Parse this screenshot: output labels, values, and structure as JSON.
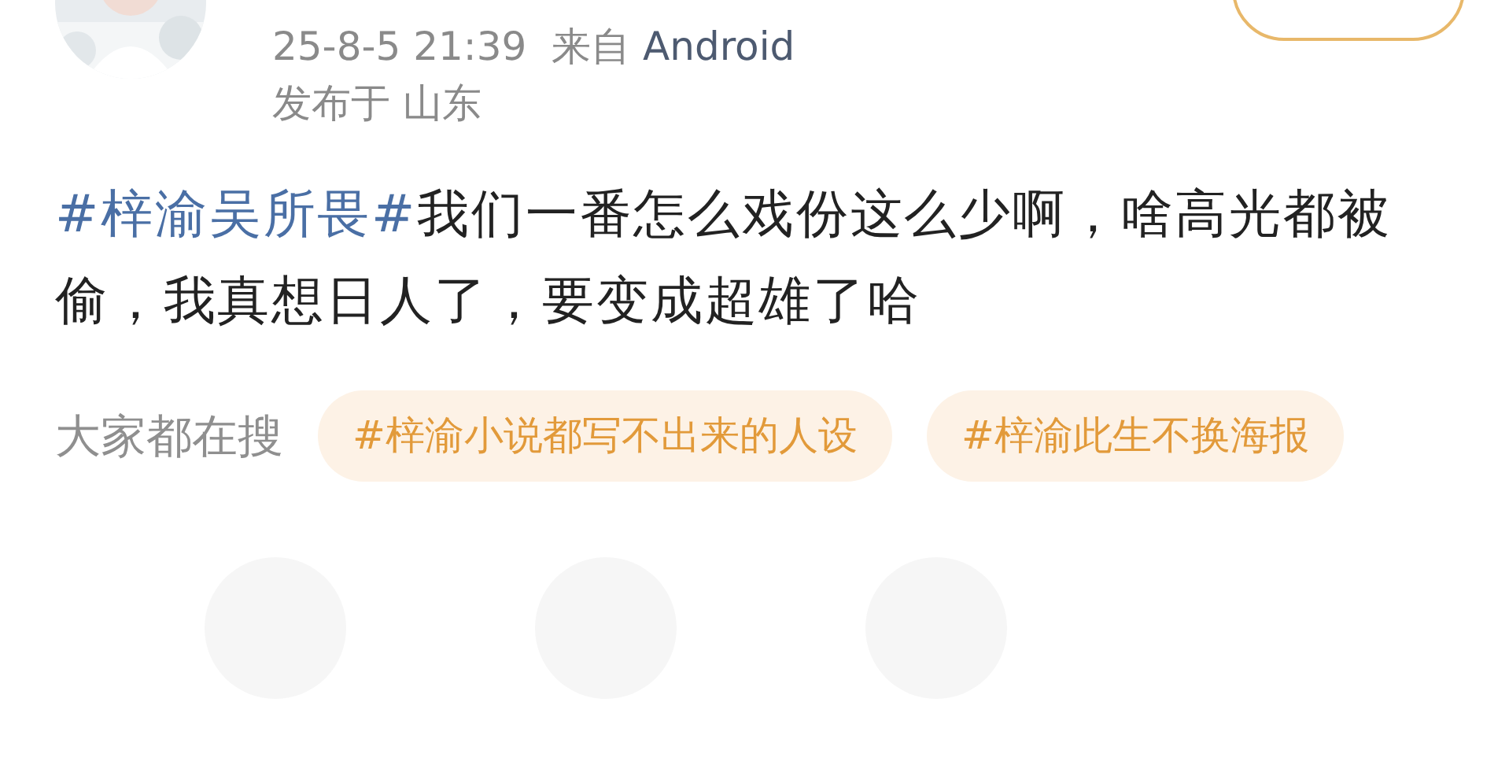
{
  "post": {
    "time": "25-8-5 21:39",
    "source_prefix": "来自",
    "source": "Android",
    "location": "发布于 山东",
    "topic": "#梓渝吴所畏#",
    "text": "我们一番怎么戏份这么少啊，啥高光都被偷，我真想日人了，要变成超雄了哈"
  },
  "follow_button": {
    "kind": "outline"
  },
  "trending": {
    "label": "大家都在搜",
    "tags": [
      "#梓渝小说都写不出来的人设",
      "#梓渝此生不换海报"
    ]
  }
}
